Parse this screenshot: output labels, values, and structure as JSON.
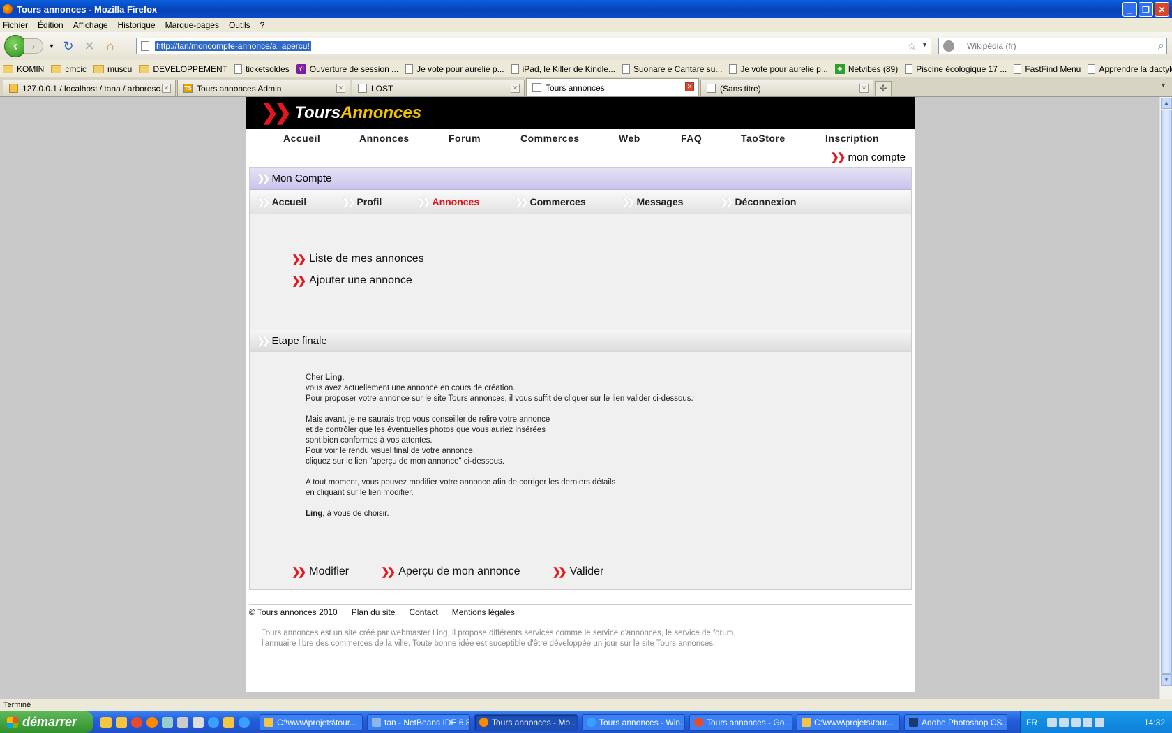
{
  "window": {
    "title": "Tours annonces - Mozilla Firefox"
  },
  "menu": [
    "Fichier",
    "Édition",
    "Affichage",
    "Historique",
    "Marque-pages",
    "Outils",
    "?"
  ],
  "address": {
    "url": "http://tan/moncompte-annonce/a=apercu!"
  },
  "search": {
    "placeholder": "Wikipédia (fr)"
  },
  "bookmarks": [
    {
      "label": "KOMIN",
      "icon": "folder-icon"
    },
    {
      "label": "cmcic",
      "icon": "folder-icon"
    },
    {
      "label": "muscu",
      "icon": "folder-icon"
    },
    {
      "label": "DEVELOPPEMENT",
      "icon": "folder-icon"
    },
    {
      "label": "ticketsoldes",
      "icon": "page-icon"
    },
    {
      "label": "Ouverture de session ...",
      "icon": "yahoo-icon"
    },
    {
      "label": "Je vote pour aurelie p...",
      "icon": "page-icon"
    },
    {
      "label": "iPad, le Killer de Kindle...",
      "icon": "page-icon"
    },
    {
      "label": "Suonare e Cantare su...",
      "icon": "page-icon"
    },
    {
      "label": "Je vote pour aurelie p...",
      "icon": "page-icon"
    },
    {
      "label": "Netvibes (89)",
      "icon": "netvibes-icon"
    },
    {
      "label": "Piscine écologique 17 ...",
      "icon": "page-icon"
    },
    {
      "label": "FastFind Menu",
      "icon": "page-icon"
    },
    {
      "label": "Apprendre la dactylog...",
      "icon": "page-icon"
    }
  ],
  "tabs": [
    {
      "label": "127.0.0.1 / localhost / tana / arboresc...",
      "icon": "pma-icon"
    },
    {
      "label": "Tours annonces Admin",
      "icon": "ts-icon"
    },
    {
      "label": "LOST",
      "icon": "page-icon"
    },
    {
      "label": "Tours annonces",
      "icon": "page-icon",
      "active": true
    },
    {
      "label": "(Sans titre)",
      "icon": "page-icon"
    }
  ],
  "site": {
    "logo_part1": "Tours",
    "logo_part2": "Annonces",
    "nav": [
      "Accueil",
      "Annonces",
      "Forum",
      "Commerces",
      "Web",
      "FAQ",
      "TaoStore",
      "Inscription"
    ],
    "mon_compte": "mon compte",
    "panel_title": "Mon Compte",
    "subnav": [
      "Accueil",
      "Profil",
      "Annonces",
      "Commerces",
      "Messages",
      "Déconnexion"
    ],
    "subnav_active": "Annonces",
    "links": [
      "Liste de mes annonces",
      "Ajouter une annonce"
    ],
    "step_title": "Etape finale",
    "message": {
      "greet_prefix": "Cher ",
      "user": "Ling",
      "greet_suffix": ",",
      "p1": [
        "vous avez actuellement une annonce en cours de création.",
        "Pour proposer votre annonce sur le site Tours annonces, il vous suffit de cliquer sur le lien valider ci-dessous."
      ],
      "p2": [
        "Mais avant, je ne saurais trop vous conseiller de relire votre annonce",
        "et de contrôler que les éventuelles photos que vous auriez insérées",
        "sont bien conformes à vos attentes.",
        "Pour voir le rendu visuel final de votre annonce,",
        "cliquez sur le lien \"aperçu de mon annonce\" ci-dessous."
      ],
      "p3": [
        "A tout moment, vous pouvez modifier votre annonce afin de corriger les derniers détails",
        "en cliquant sur le lien modifier."
      ],
      "closing_suffix": ", à vous de choisir."
    },
    "actions": [
      "Modifier",
      "Aperçu de mon annonce",
      "Valider"
    ],
    "footer": {
      "links": [
        "© Tours annonces 2010",
        "Plan du site",
        "Contact",
        "Mentions légales"
      ],
      "desc1": "Tours annonces est un site créé par webmaster Ling, il propose différents services comme le service d'annonces, le service de forum,",
      "desc2": "l'annuaire libre des commerces de la ville. Toute bonne idée est suceptible d'être développée un jour sur le site Tours annonces."
    }
  },
  "status": "Terminé",
  "taskbar": {
    "start": "démarrer",
    "items": [
      {
        "label": "C:\\www\\projets\\tour...",
        "icon": "folder-icon"
      },
      {
        "label": "tan - NetBeans IDE 6.8",
        "icon": "netbeans-icon"
      },
      {
        "label": "Tours annonces - Mo...",
        "icon": "firefox-icon",
        "active": true
      },
      {
        "label": "Tours annonces - Win...",
        "icon": "ie-icon"
      },
      {
        "label": "Tours annonces - Go...",
        "icon": "chrome-icon"
      },
      {
        "label": "C:\\www\\projets\\tour...",
        "icon": "folder-icon"
      },
      {
        "label": "Adobe Photoshop CS...",
        "icon": "photoshop-icon"
      }
    ],
    "lang": "FR",
    "clock": "14:32"
  },
  "colors": {
    "accent_red": "#e4171e",
    "logo_yellow": "#f5c400",
    "xp_blue": "#245edb"
  }
}
